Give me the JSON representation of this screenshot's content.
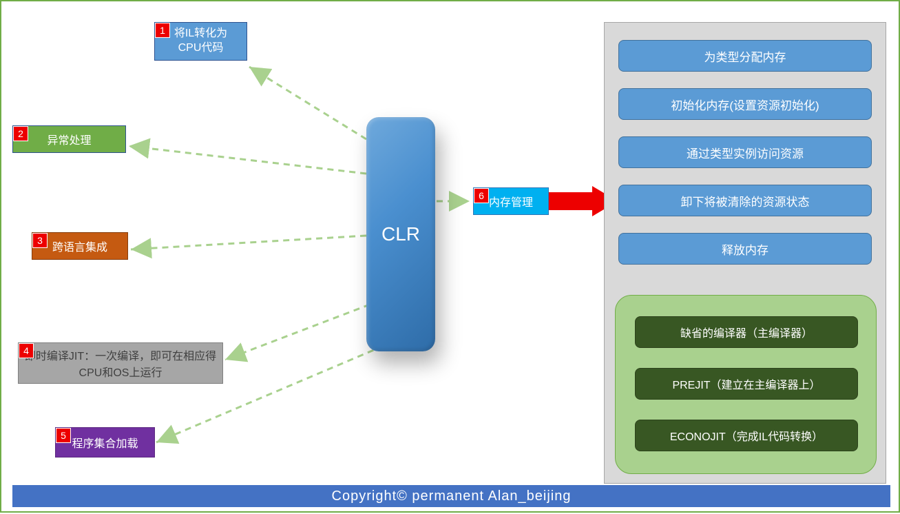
{
  "center": {
    "label": "CLR"
  },
  "left_nodes": [
    {
      "num": "1",
      "label": "将IL转化为\nCPU代码"
    },
    {
      "num": "2",
      "label": "异常处理"
    },
    {
      "num": "3",
      "label": "跨语言集成"
    },
    {
      "num": "4",
      "label": "即时编译JIT：一次编译，即可在相应得CPU和OS上运行"
    },
    {
      "num": "5",
      "label": "程序集合加载"
    }
  ],
  "right_node": {
    "num": "6",
    "label": "内存管理"
  },
  "panel_items": [
    "为类型分配内存",
    "初始化内存(设置资源初始化)",
    "通过类型实例访问资源",
    "卸下将被清除的资源状态",
    "释放内存"
  ],
  "sub_items": [
    "缺省的编译器（主编译器）",
    "PREJIT（建立在主编译器上）",
    "ECONOJIT（完成IL代码转换）"
  ],
  "footer": "Copyright©  permanent   Alan_beijing"
}
